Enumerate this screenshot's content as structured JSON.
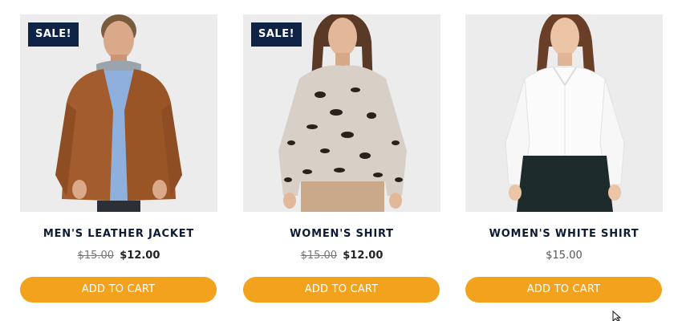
{
  "products": [
    {
      "name": "MEN'S LEATHER JACKET",
      "badge": "SALE!",
      "price_old": "$15.00",
      "price_new": "$12.00",
      "button_label": "ADD TO CART"
    },
    {
      "name": "WOMEN'S SHIRT",
      "badge": "SALE!",
      "price_old": "$15.00",
      "price_new": "$12.00",
      "button_label": "ADD TO CART"
    },
    {
      "name": "WOMEN'S WHITE SHIRT",
      "price": "$15.00",
      "button_label": "ADD TO CART"
    }
  ],
  "colors": {
    "badge_bg": "#0f2347",
    "button_bg": "#f3a21d",
    "title_text": "#0d1a33",
    "image_bg": "#ececed"
  },
  "icons": [
    "mouse-pointer-icon"
  ]
}
